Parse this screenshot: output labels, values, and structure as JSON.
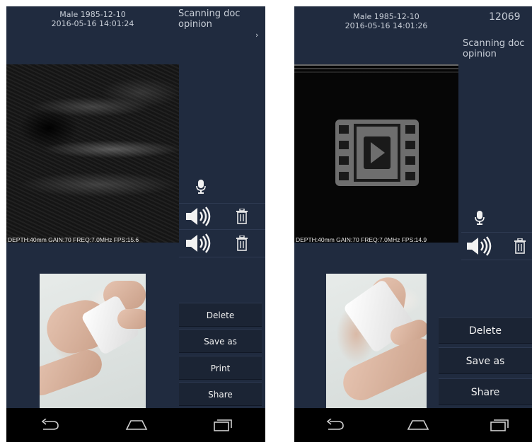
{
  "screen_left": {
    "patient": "Male 1985-12-10",
    "datetime": "2016-05-16 14:01:24",
    "doc_label": "Scanning doc\nopinion",
    "chevron": "›",
    "readout": "DEPTH:40mm GAIN:70 FREQ:7.0MHz FPS:15.6",
    "buttons": {
      "delete": "Delete",
      "save_as": "Save as",
      "print": "Print",
      "share": "Share"
    }
  },
  "screen_right": {
    "patient": "Male 1985-12-10",
    "datetime": "2016-05-16 14:01:26",
    "record_id": "12069",
    "doc_label": "Scanning doc\nopinion",
    "readout": "DEPTH:40mm GAIN:70 FREQ:7.0MHz FPS:14.9",
    "buttons": {
      "delete": "Delete",
      "save_as": "Save as",
      "share": "Share"
    }
  },
  "icons": {
    "microphone": "microphone-icon",
    "speaker": "speaker-icon",
    "trash": "trash-icon",
    "video": "video-play-icon",
    "nav_back": "back-icon",
    "nav_home": "home-icon",
    "nav_recents": "recents-icon"
  },
  "colors": {
    "background": "#202b3f",
    "button": "#1b2434",
    "text": "#c9cfd8",
    "navbar": "#000000"
  }
}
